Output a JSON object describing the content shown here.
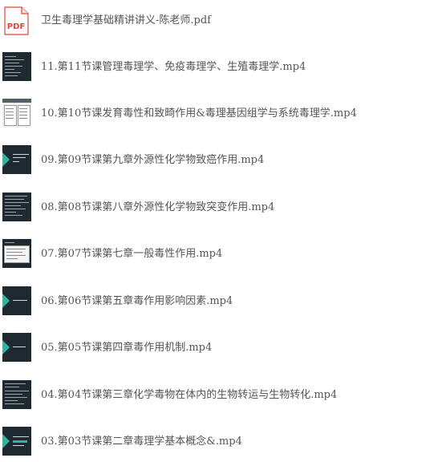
{
  "files": [
    {
      "name": "卫生毒理学基础精讲讲义-陈老师.pdf",
      "type": "pdf",
      "icon": "pdf-file-icon",
      "icon_label": "PDF",
      "icon_color": "#e0463c"
    },
    {
      "name": "11.第11节课管理毒理学、免疫毒理学、生殖毒理学.mp4",
      "type": "mp4",
      "icon": "video-thumbnail-icon"
    },
    {
      "name": "10.第10节课发育毒性和致畸作用&毒理基因组学与系统毒理学.mp4",
      "type": "mp4",
      "icon": "video-thumbnail-icon"
    },
    {
      "name": "09.第09节课第九章外源性化学物致癌作用.mp4",
      "type": "mp4",
      "icon": "video-thumbnail-icon"
    },
    {
      "name": "08.第08节课第八章外源性化学物致突变作用.mp4",
      "type": "mp4",
      "icon": "video-thumbnail-icon"
    },
    {
      "name": "07.第07节课第七章一般毒性作用.mp4",
      "type": "mp4",
      "icon": "video-thumbnail-icon"
    },
    {
      "name": "06.第06节课第五章毒作用影响因素.mp4",
      "type": "mp4",
      "icon": "video-thumbnail-icon"
    },
    {
      "name": "05.第05节课第四章毒作用机制.mp4",
      "type": "mp4",
      "icon": "video-thumbnail-icon"
    },
    {
      "name": "04.第04节课第三章化学毒物在体内的生物转运与生物转化.mp4",
      "type": "mp4",
      "icon": "video-thumbnail-icon"
    },
    {
      "name": "03.第03节课第二章毒理学基本概念&.mp4",
      "type": "mp4",
      "icon": "video-thumbnail-icon"
    }
  ],
  "colors": {
    "text": "#555555",
    "accent": "#29b6a2",
    "thumb_dark": "#1e2a30"
  }
}
